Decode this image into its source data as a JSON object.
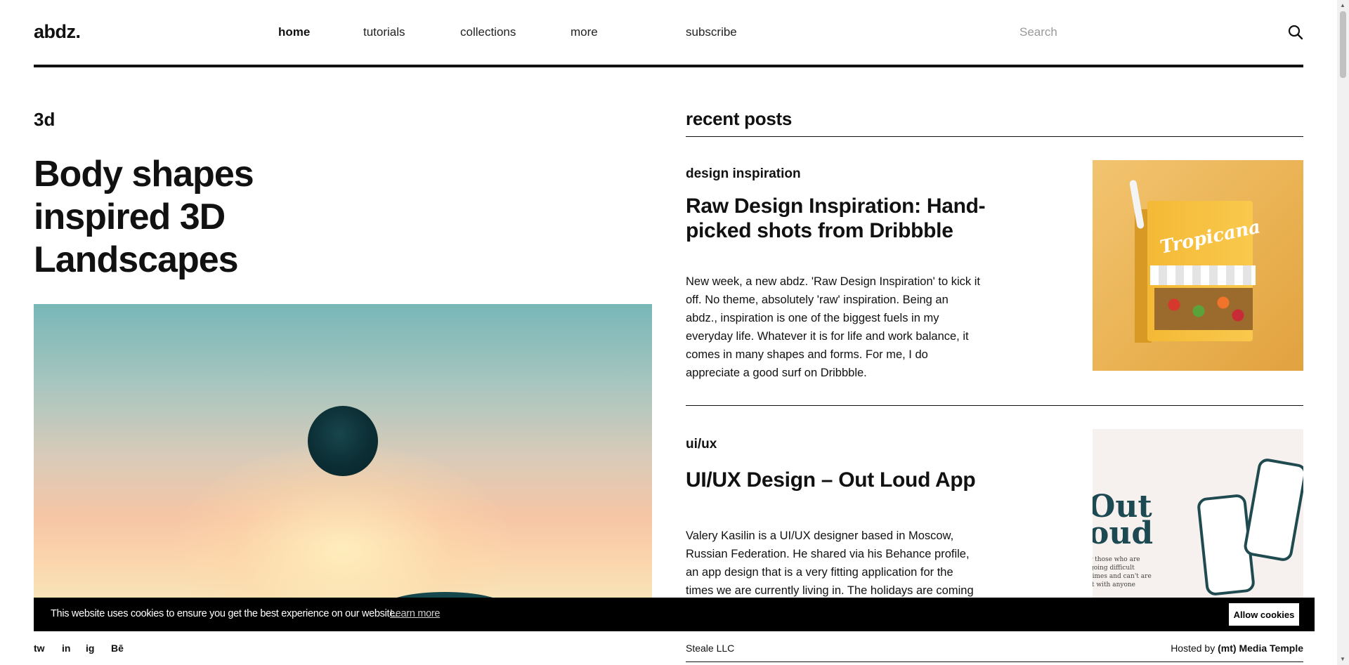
{
  "header": {
    "logo": "abdz.",
    "nav": [
      {
        "label": "home"
      },
      {
        "label": "tutorials"
      },
      {
        "label": "collections"
      },
      {
        "label": "more"
      },
      {
        "label": "subscribe"
      }
    ],
    "search_placeholder": "Search",
    "search_icon": "search-icon"
  },
  "article": {
    "category": "3d",
    "title": "Body shapes inspired 3D Landscapes"
  },
  "sidebar": {
    "heading": "recent posts",
    "posts": [
      {
        "category": "design inspiration",
        "title": "Raw Design Inspiration: Hand-picked shots from Dribbble",
        "excerpt": "New week, a new abdz. 'Raw Design Inspiration' to kick it off. No theme, absolutely 'raw' inspiration. Being an abdz., inspiration is one of the biggest fuels in my everyday life. Whatever it is for life and work balance, it comes in many shapes and forms. For me, I do appreciate a good surf on Dribbble.",
        "thumb_text": "Tropicana"
      },
      {
        "category": "ui/ux",
        "title": "UI/UX Design – Out Loud App",
        "excerpt": "Valery Kasilin is a UI/UX designer based in Moscow, Russian Federation. He shared via his Behance profile, an app design that is a very fitting application for the times we are currently living in. The holidays are coming",
        "thumb_line1": "Out",
        "thumb_line2": "oud",
        "thumb_small": "r those who are going difficult times and can't are it with anyone"
      }
    ]
  },
  "cookie": {
    "message": "This website uses cookies to ensure you get the best experience on our website.",
    "link": "Learn more",
    "button": "Allow cookies"
  },
  "footer": {
    "social": [
      "tw",
      "in",
      "ig",
      "Bē"
    ],
    "company": "Steale LLC",
    "hosted_prefix": "Hosted by",
    "hosted_name": "(mt) Media Temple"
  },
  "colors": {
    "text": "#111111",
    "cookie_bg": "#000000",
    "accent_teal": "#1d4a52"
  }
}
